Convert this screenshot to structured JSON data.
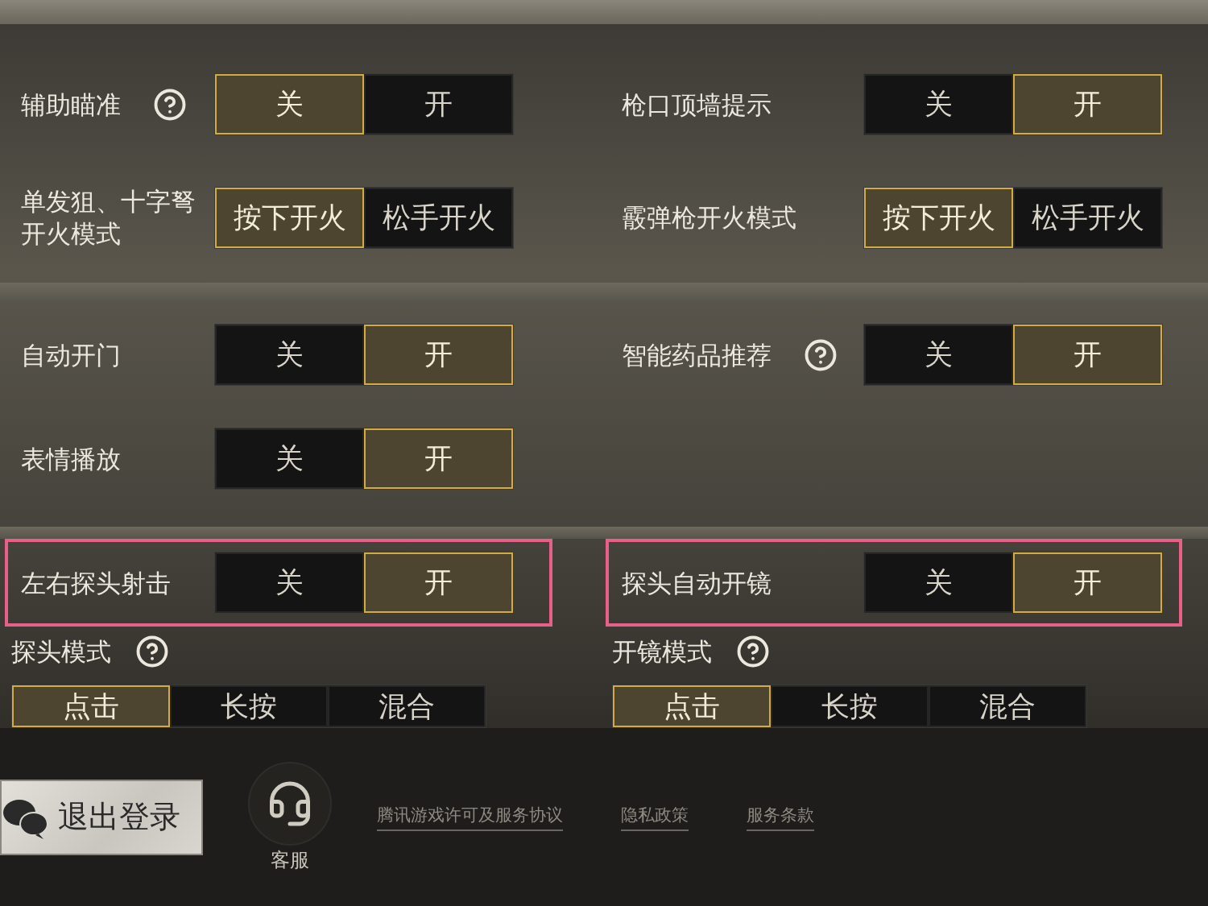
{
  "sections": [
    {
      "settings": [
        {
          "kind": "toggle",
          "label": "辅助瞄准",
          "help": true,
          "options": [
            {
              "label": "关",
              "selected": true
            },
            {
              "label": "开",
              "selected": false
            }
          ]
        },
        {
          "kind": "toggle",
          "label": "枪口顶墙提示",
          "options": [
            {
              "label": "关",
              "selected": false
            },
            {
              "label": "开",
              "selected": true
            }
          ]
        },
        {
          "kind": "toggle",
          "label": "单发狙、十字弩开火模式",
          "options": [
            {
              "label": "按下开火",
              "selected": true
            },
            {
              "label": "松手开火",
              "selected": false
            }
          ]
        },
        {
          "kind": "toggle",
          "label": "霰弹枪开火模式",
          "options": [
            {
              "label": "按下开火",
              "selected": true
            },
            {
              "label": "松手开火",
              "selected": false
            }
          ]
        }
      ]
    },
    {
      "settings": [
        {
          "kind": "toggle",
          "label": "自动开门",
          "options": [
            {
              "label": "关",
              "selected": false
            },
            {
              "label": "开",
              "selected": true
            }
          ]
        },
        {
          "kind": "toggle",
          "label": "智能药品推荐",
          "help": true,
          "options": [
            {
              "label": "关",
              "selected": false
            },
            {
              "label": "开",
              "selected": true
            }
          ]
        },
        {
          "kind": "toggle",
          "label": "表情播放",
          "options": [
            {
              "label": "关",
              "selected": false
            },
            {
              "label": "开",
              "selected": true
            }
          ]
        }
      ]
    },
    {
      "settings": [
        {
          "kind": "toggle",
          "label": "左右探头射击",
          "highlighted": true,
          "options": [
            {
              "label": "关",
              "selected": false
            },
            {
              "label": "开",
              "selected": true
            }
          ]
        },
        {
          "kind": "toggle",
          "label": "探头自动开镜",
          "highlighted": true,
          "options": [
            {
              "label": "关",
              "selected": false
            },
            {
              "label": "开",
              "selected": true
            }
          ]
        },
        {
          "kind": "segmented",
          "label": "探头模式",
          "help": true,
          "options": [
            {
              "label": "点击",
              "selected": true
            },
            {
              "label": "长按",
              "selected": false
            },
            {
              "label": "混合",
              "selected": false
            }
          ]
        },
        {
          "kind": "segmented",
          "label": "开镜模式",
          "help": true,
          "options": [
            {
              "label": "点击",
              "selected": true
            },
            {
              "label": "长按",
              "selected": false
            },
            {
              "label": "混合",
              "selected": false
            }
          ]
        }
      ]
    }
  ],
  "footer": {
    "logout_button": "退出登录",
    "support": "客服",
    "links": [
      "腾讯游戏许可及服务协议",
      "隐私政策",
      "服务条款"
    ]
  }
}
